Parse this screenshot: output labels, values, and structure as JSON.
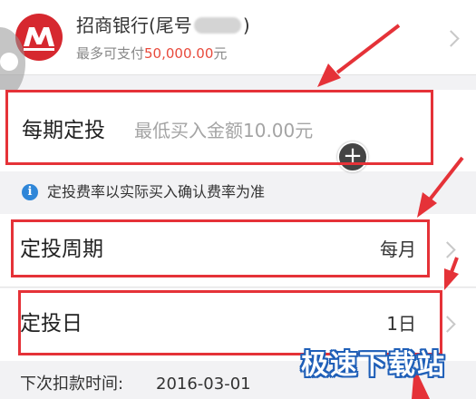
{
  "bank": {
    "name_prefix": "招商银行(尾号",
    "name_suffix": ")",
    "limit_prefix": "最多可支付",
    "limit_amount": "50,000.00",
    "limit_unit": "元",
    "logo_icon": "cmb-bank-logo-icon",
    "logo_color": "#d6282f"
  },
  "amount": {
    "label": "每期定投",
    "placeholder": "最低买入金额10.00元"
  },
  "notice": {
    "icon": "info-icon",
    "text": "定投费率以实际买入确认费率为准"
  },
  "period": {
    "label": "定投周期",
    "value": "每月"
  },
  "day": {
    "label": "定投日",
    "value": "1日"
  },
  "next": {
    "label": "下次扣款时间:",
    "value": "2016-03-01"
  },
  "watermark": "极速下载站",
  "colors": {
    "accent_red": "#e53238",
    "amount_red": "#e84a3c",
    "info_blue": "#2f86d8"
  }
}
